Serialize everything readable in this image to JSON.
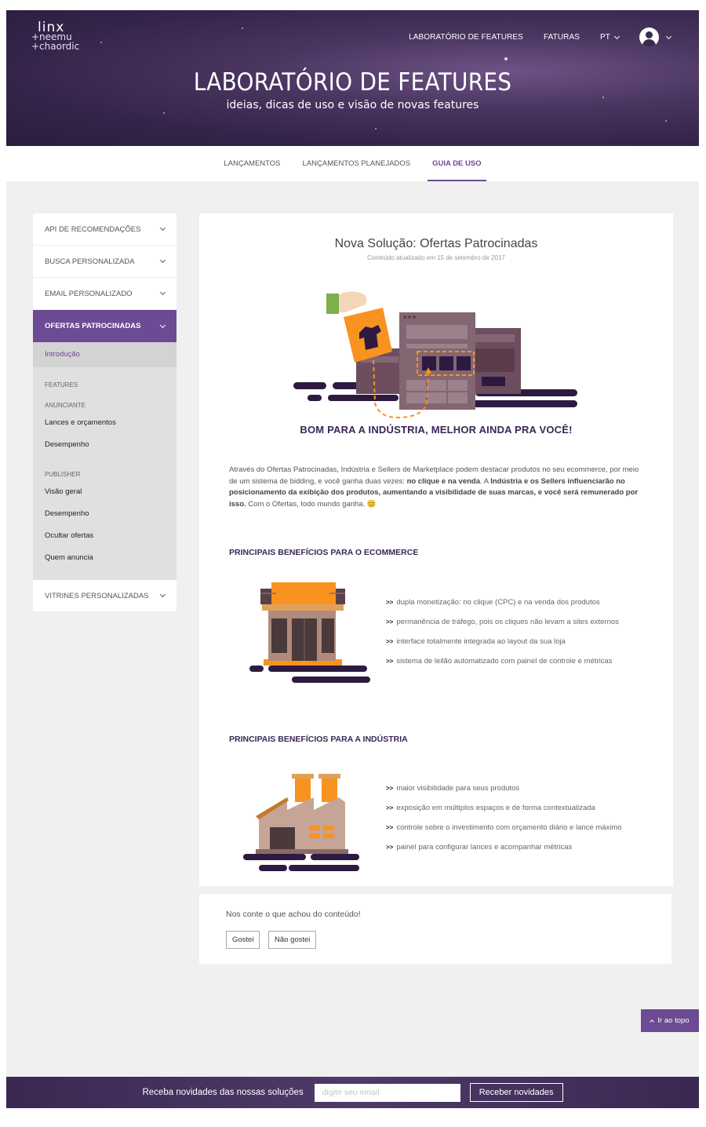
{
  "header": {
    "logo_lines": [
      "linx",
      "+neemu",
      "+chaordic"
    ],
    "nav": {
      "lab": "LABORATÓRIO DE FEATURES",
      "faturas": "FATURAS",
      "lang": "PT"
    },
    "title": "LABORATÓRIO DE FEATURES",
    "subtitle": "ideias, dicas de uso e visão de novas features"
  },
  "tabs": [
    "LANÇAMENTOS",
    "LANÇAMENTOS PLANEJADOS",
    "GUIA DE USO"
  ],
  "active_tab": "GUIA DE USO",
  "sidebar": {
    "items": [
      "API DE RECOMENDAÇÕES",
      "BUSCA PERSONALIZADA",
      "EMAIL PERSONALIZADO",
      "OFERTAS PATROCINADAS",
      "VITRINES PERSONALIZADAS"
    ],
    "sub": {
      "intro": "Introdução",
      "features": "FEATURES",
      "anunciante": "ANUNCIANTE",
      "anunciante_links": [
        "Lances e orçamentos",
        "Desempenho"
      ],
      "publisher": "PUBLISHER",
      "publisher_links": [
        "Visão geral",
        "Desempenho",
        "Ocultar ofertas",
        "Quem anuncia"
      ]
    }
  },
  "article": {
    "title": "Nova Solução: Ofertas Patrocinadas",
    "updated": "Conteúdo atualizado em 15 de setembro de 2017",
    "slogan": "BOM PARA A INDÚSTRIA, MELHOR AINDA PRA VOCÊ!",
    "intro_a": "Através do Ofertas Patrocinadas, Indústria e Sellers de Marketplace podem destacar produtos no seu ecommerce, por meio de um sistema de bidding, e você ganha duas vezes: ",
    "intro_b": "no clique e na venda",
    "intro_c": ". A ",
    "intro_d": "Indústria e os Sellers influenciarão no posicionamento da exibição dos produtos, aumentando a visibilidade de suas marcas, e você será remunerado por isso.",
    "intro_e": " Com o Ofertas, todo mundo ganha. 😊",
    "section1_title": "PRINCIPAIS BENEFÍCIOS PARA O ECOMMERCE",
    "section1_items": [
      "dupla monetização: no clique (CPC) e na venda dos produtos",
      "permanência de tráfego, pois os cliques não levam a sites externos",
      "interface totalmente integrada ao layout da sua loja",
      "sistema de leilão automatizado com painel de controle e métricas"
    ],
    "section2_title": "PRINCIPAIS BENEFÍCIOS PARA A INDÚSTRIA",
    "section2_items": [
      "maior visibilidade para seus produtos",
      "exposição em múltiplos espaços e de forma contextualizada",
      "controle sobre o investimento com orçamento diário e lance máximo",
      "painel para configurar lances e acompanhar métricas"
    ],
    "bullet": ">>"
  },
  "feedback": {
    "question": "Nos conte o que achou do conteúdo!",
    "like": "Gostei",
    "dislike": "Não gostei"
  },
  "to_top": "Ir ao topo",
  "footer": {
    "text": "Receba novidades das nossas soluções",
    "placeholder": "digite seu email",
    "button": "Receber novidades"
  },
  "colors": {
    "brand_purple": "#6b4b93",
    "dark_purple": "#3a2755",
    "orange": "#f7931e"
  }
}
